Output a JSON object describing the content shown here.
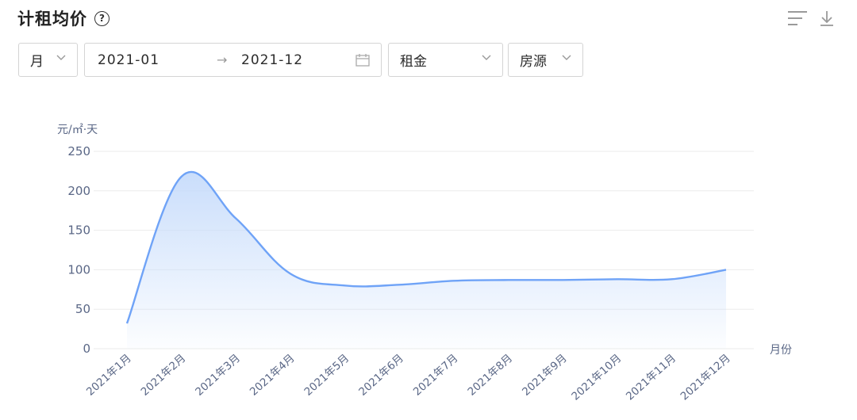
{
  "header": {
    "title": "计租均价",
    "help_icon": "question-circle-icon",
    "tool_icons": [
      "list-settings-icon",
      "download-icon"
    ]
  },
  "filters": {
    "period": {
      "value": "月",
      "icon": "chevron-down-icon"
    },
    "date_range": {
      "start": "2021-01",
      "separator": "→",
      "end": "2021-12",
      "icon": "calendar-icon"
    },
    "metric": {
      "value": "租金",
      "icon": "chevron-down-icon"
    },
    "dimension": {
      "value": "房源",
      "icon": "chevron-down-icon"
    }
  },
  "colors": {
    "line": "#6fa3f7",
    "area_top": "#c7dcfb",
    "grid": "#ebebeb",
    "axis_text": "#5a6786"
  },
  "chart_data": {
    "type": "area",
    "categories": [
      "2021年1月",
      "2021年2月",
      "2021年3月",
      "2021年4月",
      "2021年5月",
      "2021年6月",
      "2021年7月",
      "2021年8月",
      "2021年9月",
      "2021年10月",
      "2021年11月",
      "2021年12月"
    ],
    "series": [
      {
        "values": [
          32,
          218,
          165,
          95,
          80,
          81,
          86,
          87,
          87,
          88,
          88,
          100
        ]
      }
    ],
    "ylabel": "元/㎡·天",
    "xlabel": "月份",
    "yticks": [
      0,
      50,
      100,
      150,
      200,
      250
    ],
    "ylim": [
      0,
      250
    ],
    "grid": true,
    "legend": "none"
  }
}
